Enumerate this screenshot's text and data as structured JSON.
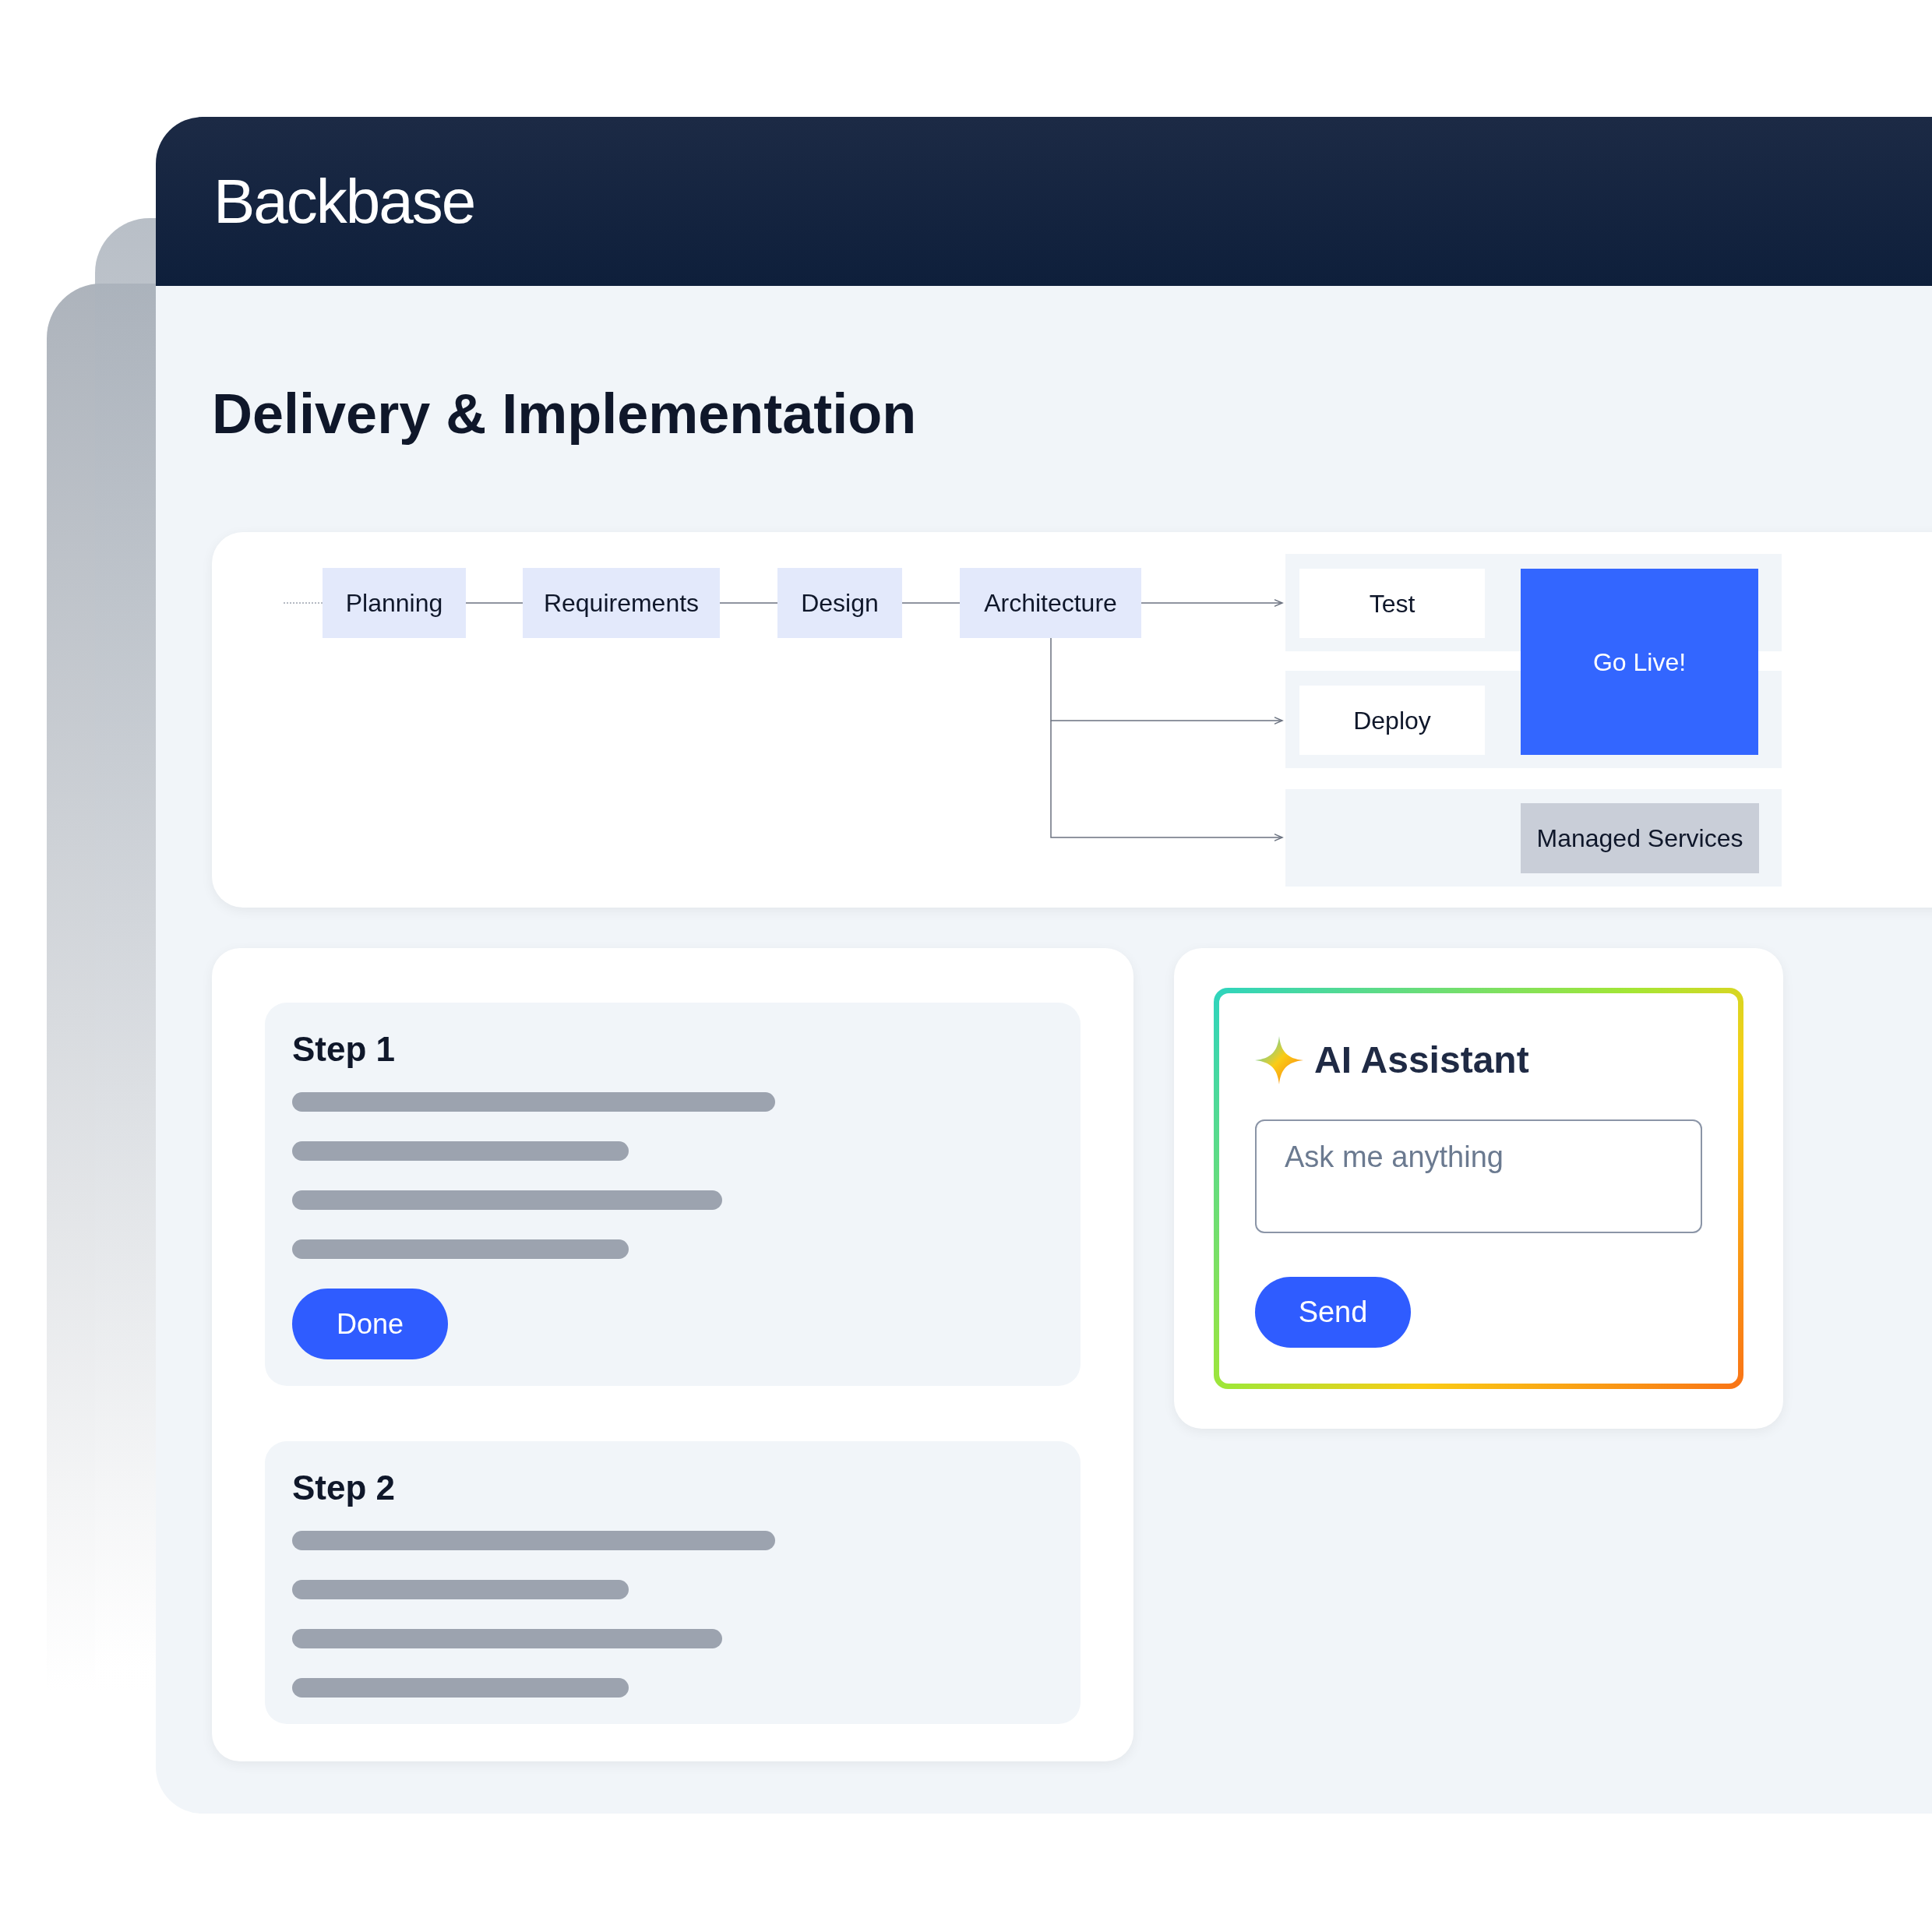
{
  "brand": "Backbase",
  "title": "Delivery & Implementation",
  "pipeline": {
    "stages": [
      {
        "label": "Planning"
      },
      {
        "label": "Requirements"
      },
      {
        "label": "Design"
      },
      {
        "label": "Architecture"
      }
    ],
    "lanes": [
      {
        "label": "Test"
      },
      {
        "label": "Deploy"
      }
    ],
    "go_live": "Go Live!",
    "managed": "Managed Services"
  },
  "steps": [
    {
      "title": "Step 1",
      "button": "Done"
    },
    {
      "title": "Step 2"
    }
  ],
  "assistant": {
    "title": "AI Assistant",
    "placeholder": "Ask me anything",
    "button": "Send"
  }
}
